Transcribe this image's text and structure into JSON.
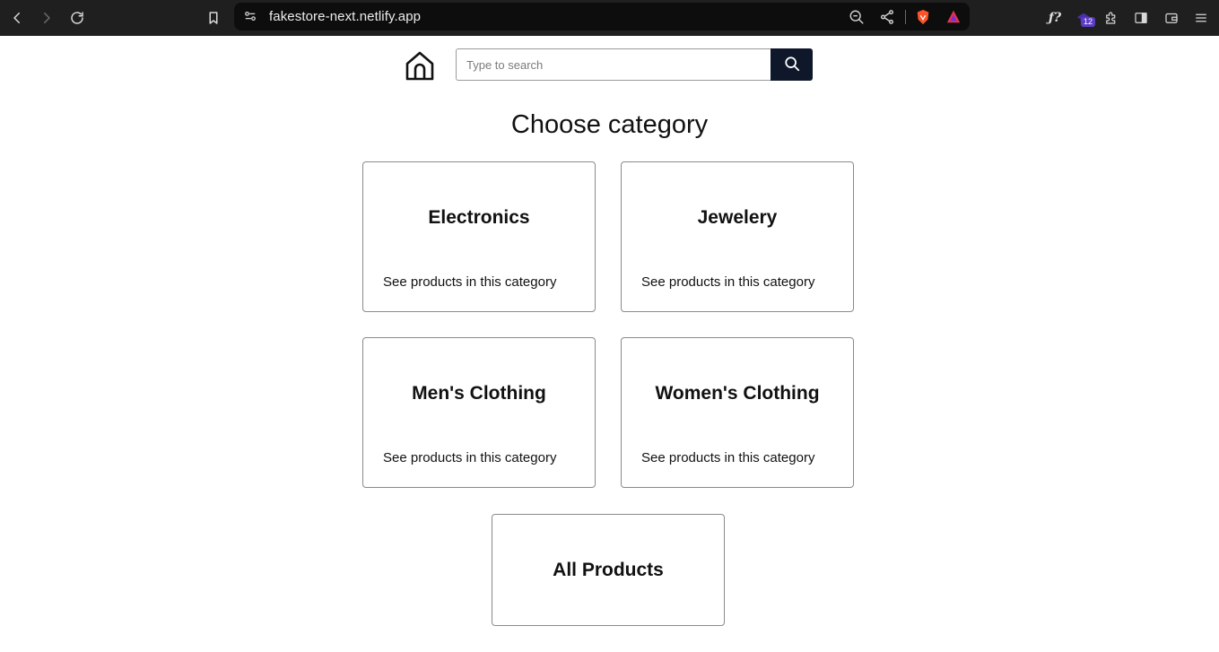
{
  "browser": {
    "url": "fakestore-next.netlify.app",
    "extension_badge": "12"
  },
  "search": {
    "placeholder": "Type to search",
    "value": ""
  },
  "page": {
    "title": "Choose category"
  },
  "categories": [
    {
      "title": "Electronics",
      "subtitle": "See products in this category"
    },
    {
      "title": "Jewelery",
      "subtitle": "See products in this category"
    },
    {
      "title": "Men's Clothing",
      "subtitle": "See products in this category"
    },
    {
      "title": "Women's Clothing",
      "subtitle": "See products in this category"
    },
    {
      "title": "All Products"
    }
  ],
  "colors": {
    "chrome_bg": "#1f1f1f",
    "url_bg": "#0d0d0d",
    "search_button_bg": "#0f172a",
    "card_border": "#8a8a8a",
    "brave_orange": "#fb542b",
    "extension_badge": "#5b3cc4"
  },
  "icons": {
    "back": "back-arrow-icon",
    "forward": "forward-arrow-icon",
    "reload": "reload-icon",
    "bookmark": "bookmark-icon",
    "site_settings": "site-settings-icon",
    "zoom": "zoom-out-icon",
    "share": "share-icon",
    "brave": "brave-shield-icon",
    "rewards": "brave-rewards-icon",
    "home": "home-icon",
    "search": "search-icon"
  }
}
